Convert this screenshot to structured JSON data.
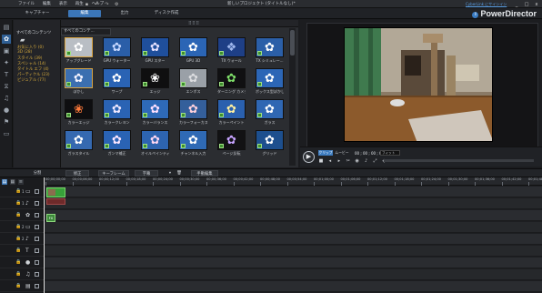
{
  "titlebar": {
    "menu": [
      "ファイル",
      "編集",
      "表示",
      "再生",
      "ヘルプ"
    ],
    "project_title": "新しいプロジェクト (タイトルなし)*",
    "link": "CyberLink にサインイン",
    "window_controls": [
      "_",
      "□",
      "x"
    ]
  },
  "header": {
    "modes": [
      {
        "label": "キャプチャー",
        "active": false
      },
      {
        "label": "編集",
        "active": true
      },
      {
        "label": "出力",
        "active": false
      },
      {
        "label": "ディスク作成",
        "active": false
      }
    ],
    "brand": "PowerDirector",
    "brand_icon": "cyberlink-icon"
  },
  "left_tools": [
    "media-icon",
    "effect-icon",
    "pip-icon",
    "particle-icon",
    "title-icon",
    "transition-icon",
    "audio-mix-icon",
    "voiceover-icon",
    "chapter-icon",
    "subtitle-icon"
  ],
  "category_panel": {
    "title": "すべてのコンテンツ",
    "folder_icon": "folder-icon",
    "items": [
      "お気に入り (0)",
      "3D (28)",
      "スタイル (39)",
      "スペシャル (14)",
      "タイトル エフ (4)",
      "パーティクル (23)",
      "ビジュアル (77)"
    ]
  },
  "library": {
    "filter": "すべてのコンテ...",
    "grip": "⠿⠿⠿",
    "tiles": [
      {
        "label": "アップグレード",
        "glyph": "✿",
        "bg": "#b9bec4",
        "fg": "#ffffff",
        "selected": true
      },
      {
        "label": "GPU ウォーター",
        "glyph": "✿",
        "bg": "#2a5ea8",
        "fg": "#c7d8ff"
      },
      {
        "label": "GPU スター",
        "glyph": "✿",
        "bg": "#1f4f9c",
        "fg": "#e7e1ff"
      },
      {
        "label": "GPU 3D",
        "glyph": "✿",
        "bg": "#2b65b5",
        "fg": "#ffffff"
      },
      {
        "label": "TX ウォール",
        "glyph": "❖",
        "bg": "#1e3f86",
        "fg": "#9fb8ee"
      },
      {
        "label": "TX シミュレー...",
        "glyph": "✿",
        "bg": "#2b5fa8",
        "fg": "#ffffff"
      },
      {
        "label": "ぼかし",
        "glyph": "✿",
        "bg": "#3b6fb0",
        "fg": "#f3f3ff",
        "selected": true
      },
      {
        "label": "ワープ",
        "glyph": "✿",
        "bg": "#2a63b4",
        "fg": "#ffffff"
      },
      {
        "label": "エッジ",
        "glyph": "❀",
        "bg": "#0f0f10",
        "fg": "#ffffff"
      },
      {
        "label": "エンボス",
        "glyph": "✿",
        "bg": "#9aa0a7",
        "fg": "#dcdde0"
      },
      {
        "label": "ターニング カメラ",
        "glyph": "✿",
        "bg": "#101012",
        "fg": "#7fe06a"
      },
      {
        "label": "ボックス型ぼかし",
        "glyph": "✿",
        "bg": "#2c66b6",
        "fg": "#ffffff"
      },
      {
        "label": "カラーエッジ",
        "glyph": "❀",
        "bg": "#0e0e10",
        "fg": "#ff7a3a"
      },
      {
        "label": "カラークレヨン",
        "glyph": "✿",
        "bg": "#2a63b4",
        "fg": "#f1e9ff"
      },
      {
        "label": "カラーバランス",
        "glyph": "✿",
        "bg": "#2e6ab8",
        "fg": "#ffe0ff"
      },
      {
        "label": "カラーフォーカス",
        "glyph": "✿",
        "bg": "#345f9b",
        "fg": "#ffd1dc"
      },
      {
        "label": "カラーペイント",
        "glyph": "✿",
        "bg": "#2a60ae",
        "fg": "#fff0a0"
      },
      {
        "label": "ガラス",
        "glyph": "✿",
        "bg": "#2f67b3",
        "fg": "#ffffff"
      },
      {
        "label": "ガラスタイル",
        "glyph": "✿",
        "bg": "#3569b0",
        "fg": "#ffffff"
      },
      {
        "label": "ガンマ補正",
        "glyph": "✿",
        "bg": "#2a63b4",
        "fg": "#ffe7ff"
      },
      {
        "label": "オイルペインティング",
        "glyph": "✿",
        "bg": "#2d64b0",
        "fg": "#ffd7f2"
      },
      {
        "label": "チャンネル入力",
        "glyph": "✿",
        "bg": "#2f6ab5",
        "fg": "#ffffff"
      },
      {
        "label": "ページ反転",
        "glyph": "✿",
        "bg": "#121214",
        "fg": "#c7a3ff"
      },
      {
        "label": "グリッド",
        "glyph": "✿",
        "bg": "#1d4f8e",
        "fg": "#ffffff"
      }
    ]
  },
  "preview": {
    "tabs": [
      {
        "label": "クリップ",
        "active": true
      },
      {
        "label": "ムービー",
        "active": false
      }
    ],
    "timecode": "00 ; 00 ; 00 ; 00",
    "zoom": "フィット",
    "play_icon": "play-icon",
    "buttons": [
      "stop-icon",
      "prev-frame-icon",
      "next-frame-icon",
      "split-icon",
      "snapshot-icon",
      "volume-icon",
      "fullscreen-icon",
      "3d-icon"
    ]
  },
  "edit_toolbar": {
    "items": [
      "分割",
      "修正",
      "キーフレーム",
      "字幕",
      "手動編集"
    ],
    "icons": [
      "clip-options-icon",
      "trash-icon"
    ]
  },
  "timeline": {
    "ruler": [
      "00;00;00;00",
      "00;00;06;00",
      "00;00;12;00",
      "00;00;18;00",
      "00;00;24;00",
      "00;00;30;00",
      "00;00;36;00",
      "00;00;42;00",
      "00;00;48;00",
      "00;00;54;00",
      "00;01;00;00",
      "00;01;06;00",
      "00;01;12;00",
      "00;01;18;00",
      "00;01;24;00",
      "00;01;30;00",
      "00;01;36;00",
      "00;01;42;00",
      "00;01;48;00"
    ],
    "tracks": [
      {
        "num": "1",
        "icon": "video-track-icon"
      },
      {
        "num": "1",
        "icon": "audio-track-icon"
      },
      {
        "num": "",
        "icon": "fx-track-icon"
      },
      {
        "num": "2",
        "icon": "video-track-icon"
      },
      {
        "num": "2",
        "icon": "audio-track-icon"
      },
      {
        "num": "",
        "icon": "title-track-icon"
      },
      {
        "num": "",
        "icon": "voice-track-icon"
      },
      {
        "num": "",
        "icon": "music-track-icon"
      },
      {
        "num": "",
        "icon": "subtitle-track-icon"
      }
    ],
    "clip_fx_label": "FX"
  }
}
